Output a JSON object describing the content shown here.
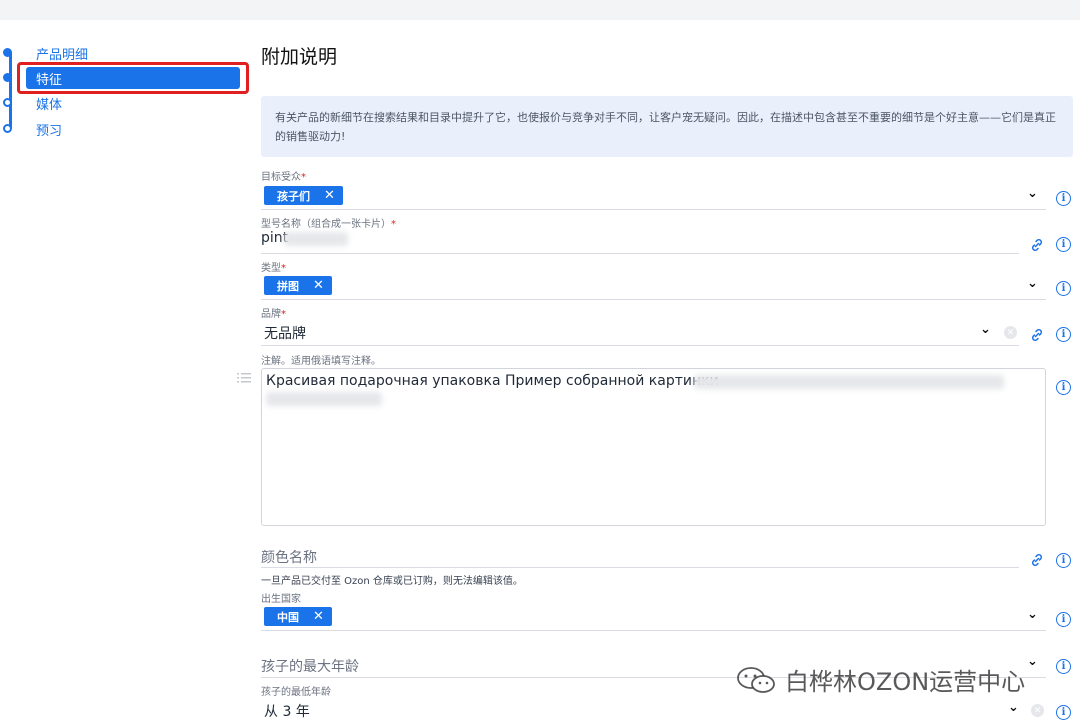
{
  "steps": [
    {
      "label": "产品明细",
      "state": "done"
    },
    {
      "label": "特征",
      "state": "active"
    },
    {
      "label": "媒体",
      "state": "todo"
    },
    {
      "label": "预习",
      "state": "todo"
    }
  ],
  "section_title": "附加说明",
  "info_text": "有关产品的新细节在搜索结果和目录中提升了它，也使报价与竞争对手不同，让客户宠无疑问。因此，在描述中包含甚至不重要的细节是个好主意——它们是真正的销售驱动力!",
  "fields": {
    "audience": {
      "label": "目标受众",
      "req": "*",
      "chip": "孩子们",
      "remove": "✕"
    },
    "model": {
      "label": "型号名称（组合成一张卡片）",
      "req": "*",
      "value": "pint"
    },
    "type": {
      "label": "类型",
      "req": "*",
      "chip": "拼图",
      "remove": "✕"
    },
    "brand": {
      "label": "品牌",
      "req": "*",
      "value": "无品牌"
    },
    "annotation": {
      "label": "注解。适用俄语填写注释。",
      "value": "Красивая подарочная упаковка Пример собранной картинки"
    },
    "color_name": {
      "placeholder": "颜色名称",
      "hint": "一旦产品已交付至 Ozon 仓库或已订购，则无法编辑该值。"
    },
    "origin": {
      "label": "出生国家",
      "chip": "中国",
      "remove": "✕"
    },
    "max_age": {
      "placeholder": "孩子的最大年龄"
    },
    "min_age": {
      "label": "孩子的最低年龄",
      "value": "从 3 年"
    }
  },
  "watermark": "白桦林OZON运营中心",
  "colors": {
    "accent": "#1a73e8",
    "highlight_border": "#e02020",
    "info_bg": "#eaf0fb"
  }
}
